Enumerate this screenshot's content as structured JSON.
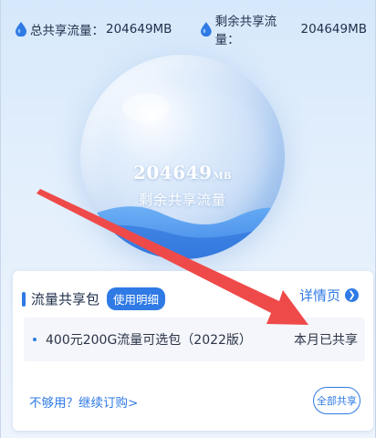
{
  "stats": {
    "total_label": "总共享流量：",
    "total_value": "204649MB",
    "remaining_label": "剩余共享流量：",
    "remaining_value": "204649MB"
  },
  "bubble": {
    "number": "204649",
    "unit": "MB",
    "label": "剩余共享流量"
  },
  "card": {
    "title": "流量共享包",
    "usage_button": "使用明细",
    "detail_link": "详情页",
    "package_name": "400元200G流量可选包（2022版）",
    "package_status": "本月已共享",
    "renew_link": "不够用？继续订购>",
    "share_all_button": "全部共享"
  },
  "colors": {
    "accent": "#2f7ae5",
    "annotation_arrow": "#ef4a4a"
  },
  "icons": [
    "water-drop-icon",
    "chevron-right-icon",
    "annotation-arrow"
  ]
}
